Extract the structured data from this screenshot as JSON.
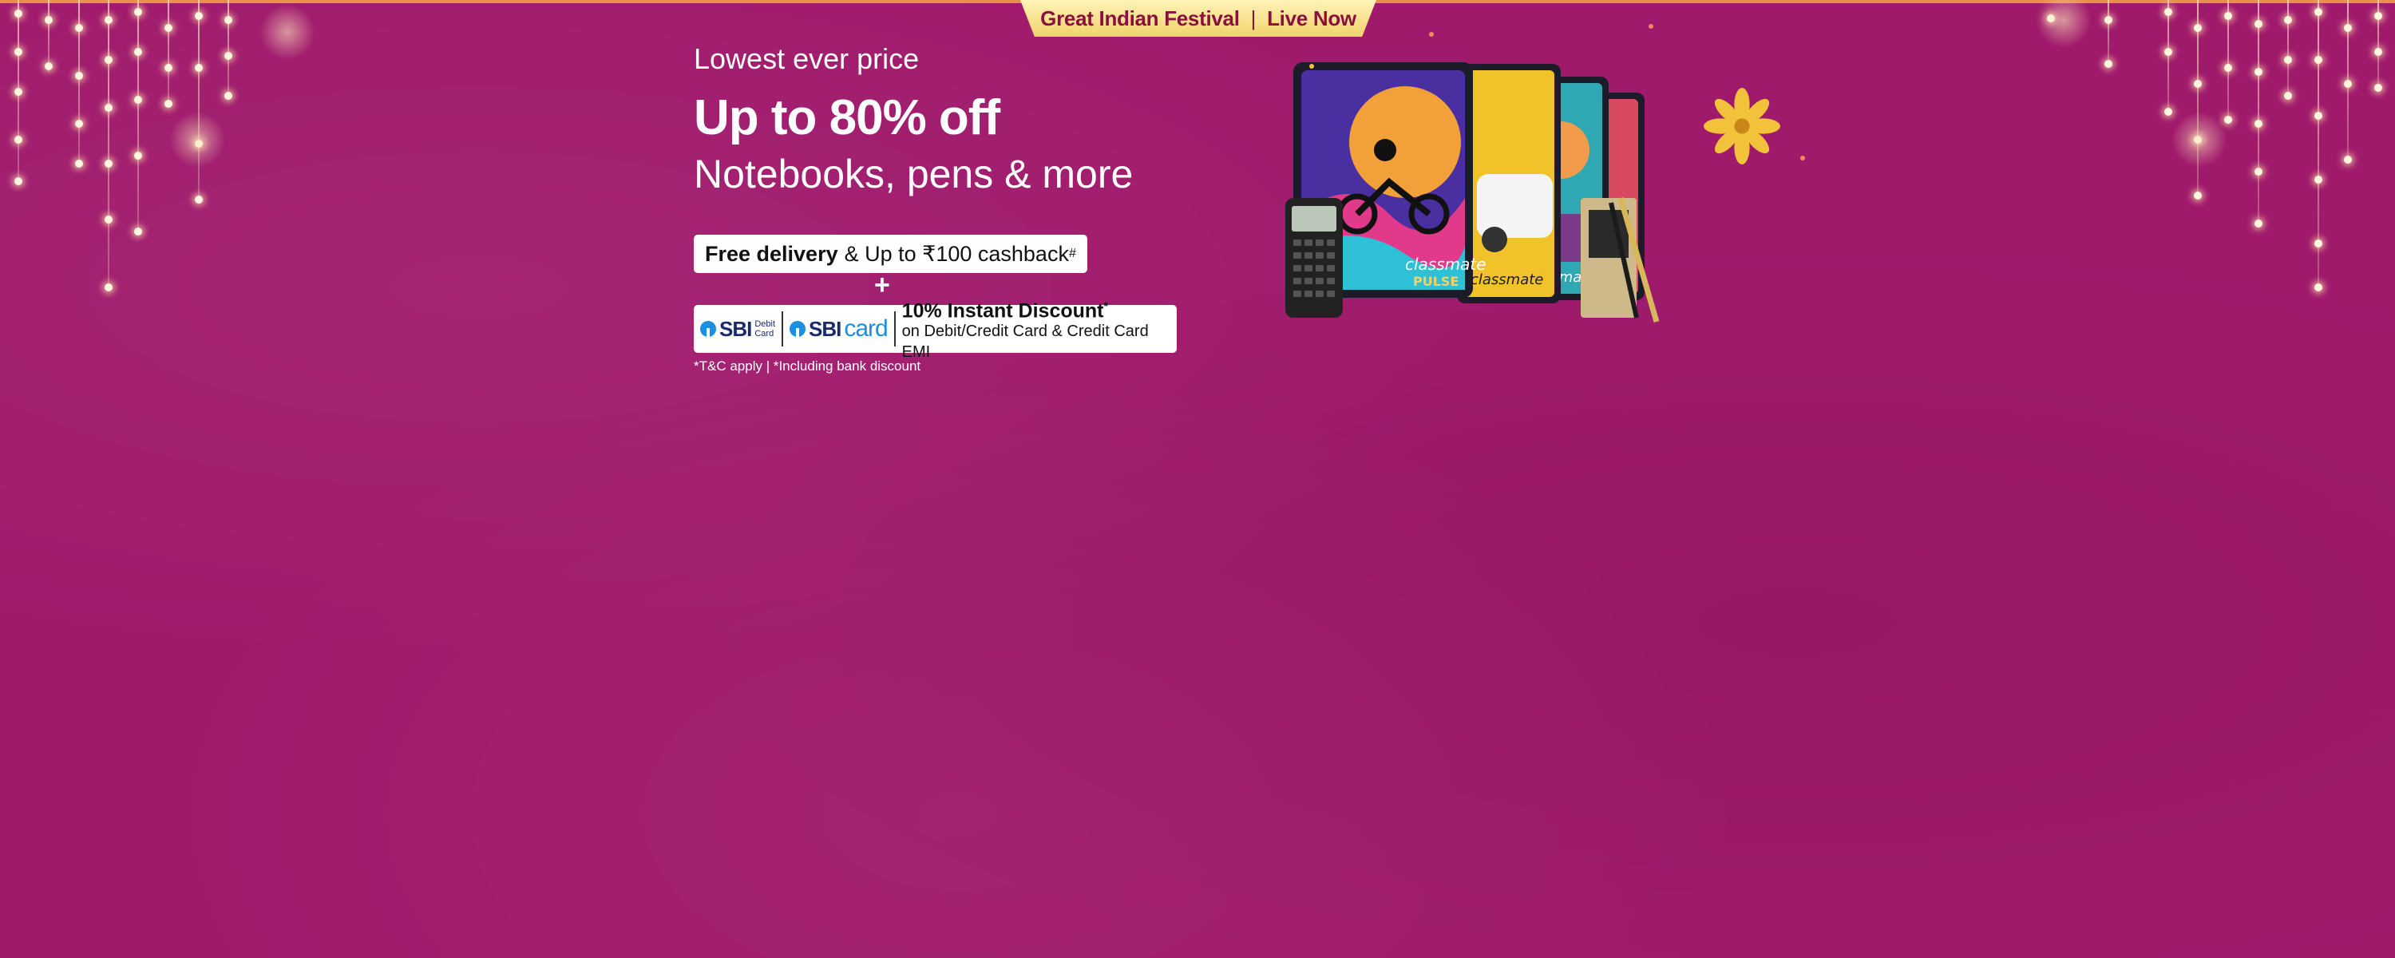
{
  "banner": {
    "festival_name": "Great Indian Festival",
    "separator": "|",
    "festival_status": "Live Now",
    "eyebrow": "Lowest ever price",
    "headline": "Up to 80% off",
    "subhead": "Notebooks, pens & more",
    "delivery_bold": "Free delivery",
    "delivery_rest": "& Up to ₹100 cashback",
    "delivery_mark": "#",
    "plus": "+",
    "bank": {
      "sbi_logo_text": "SBI",
      "sbi_sub_line1": "Debit",
      "sbi_sub_line2": "Card",
      "card_logo_sbi": "SBI",
      "card_logo_card": "card",
      "offer_title": "10% Instant Discount",
      "offer_mark": "*",
      "offer_sub": "on Debit/Credit Card & Credit Card EMI"
    },
    "tnc": "*T&C apply | *Including bank discount",
    "product_brand": "classmate",
    "product_series": "PULSE"
  },
  "colors": {
    "background": "#a01a6c",
    "tag": "#f2d36a",
    "tag_text": "#8a1040",
    "sbi_blue": "#1d8ee0",
    "sbi_navy": "#1a2b6b",
    "flower": "#f2c23a"
  },
  "icons": [
    "festive-lights-icon",
    "sbi-logo-icon",
    "flower-icon",
    "calculator-icon",
    "pen-icon"
  ]
}
